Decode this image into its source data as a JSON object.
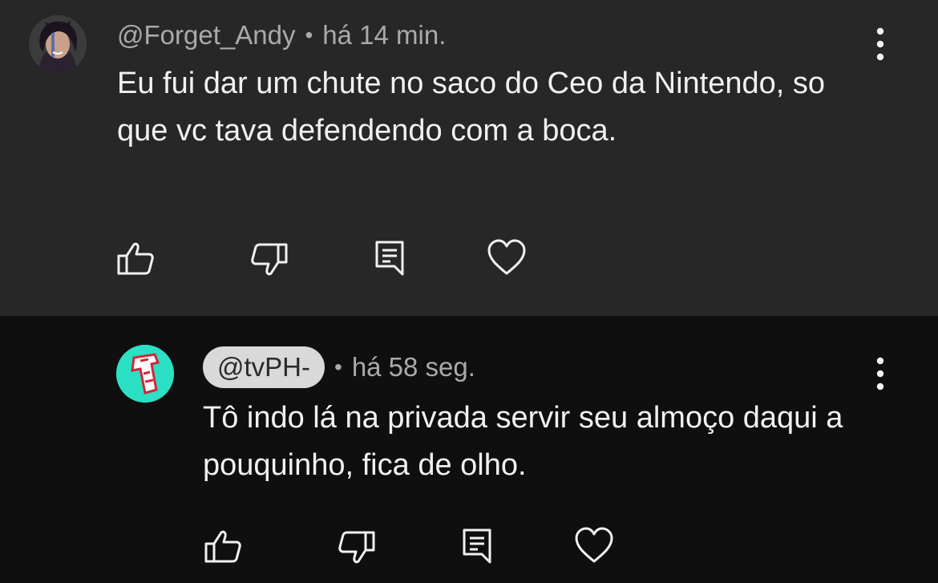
{
  "comments": [
    {
      "author": "@Forget_Andy",
      "separator": "•",
      "time": "há 14 min.",
      "text": "Eu fui dar um chute no saco do Ceo da Nintendo, so que vc tava defendendo com a boca.",
      "avatar_icon": "user-avatar-andy",
      "actions": [
        "like-icon",
        "dislike-icon",
        "reply-icon",
        "heart-icon"
      ]
    },
    {
      "author": "@tvPH-",
      "separator": "•",
      "time": "há 58 seg.",
      "text": "Tô indo lá na privada servir seu almoço daqui a pouquinho, fica de olho.",
      "avatar_icon": "channel-avatar-tvph",
      "author_highlight_color": "#d9d9d9",
      "actions": [
        "like-icon",
        "dislike-icon",
        "reply-icon",
        "heart-icon"
      ]
    }
  ],
  "colors": {
    "top_comment_bg": "#272727",
    "reply_bg": "#0f0f0f",
    "avatar_tvph_bg": "#2be0c4"
  }
}
